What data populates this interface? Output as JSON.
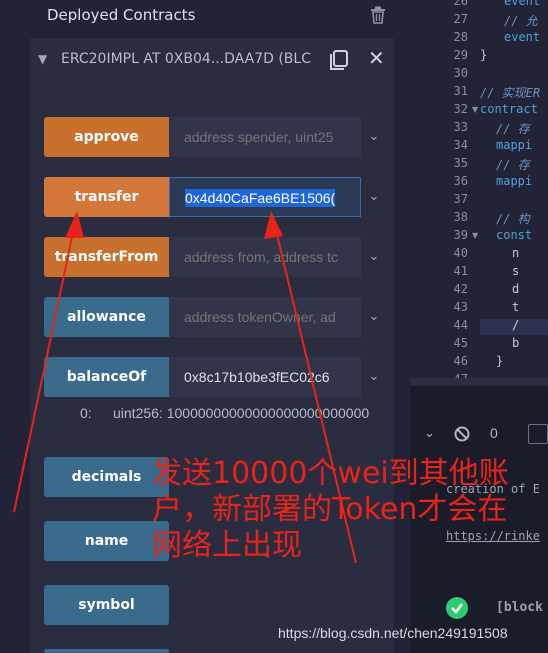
{
  "deployed_panel": {
    "title": "Deployed Contracts",
    "trash_icon": "trash-icon"
  },
  "instance": {
    "title": "ERC20IMPL AT 0XB04...DAA7D (BLC",
    "chevron_icon": "chevron-down-icon",
    "copy_icon": "copy-icon",
    "close_icon": "close-icon"
  },
  "functions": [
    {
      "label": "approve",
      "input_placeholder": "address spender, uint25",
      "input_value": "",
      "style": "orange"
    },
    {
      "label": "transfer",
      "input_placeholder": "",
      "input_value": "0x4d40CaFae6BE1506(",
      "style": "orange-active"
    },
    {
      "label": "transferFrom",
      "input_placeholder": "address from, address tc",
      "input_value": "",
      "style": "orange"
    },
    {
      "label": "allowance",
      "input_placeholder": "address tokenOwner, ad",
      "input_value": "",
      "style": "blue"
    },
    {
      "label": "balanceOf",
      "input_placeholder": "",
      "input_value": "0x8c17b10be3fEC02c6",
      "style": "blue"
    }
  ],
  "balance_result": {
    "index": "0:",
    "value": "uint256: 10000000000000000000000000"
  },
  "getters": [
    {
      "label": "decimals"
    },
    {
      "label": "name"
    },
    {
      "label": "symbol"
    }
  ],
  "editor": {
    "lines": [
      {
        "num": "26",
        "text": "event",
        "kind": "kw",
        "indent": 3
      },
      {
        "num": "27",
        "text": "// 允",
        "kind": "cm",
        "indent": 3
      },
      {
        "num": "28",
        "text": "event",
        "kind": "kw",
        "indent": 3
      },
      {
        "num": "29",
        "text": "}",
        "kind": "pl",
        "indent": 0
      },
      {
        "num": "30",
        "text": "",
        "kind": "pl",
        "indent": 0
      },
      {
        "num": "31",
        "text": "// 实现ER",
        "kind": "cm",
        "indent": 0
      },
      {
        "num": "32",
        "text": "contract",
        "kind": "kw",
        "indent": 0,
        "fold": true
      },
      {
        "num": "33",
        "text": "// 存",
        "kind": "cm",
        "indent": 2
      },
      {
        "num": "34",
        "text": "mappi",
        "kind": "kw",
        "indent": 2
      },
      {
        "num": "35",
        "text": "// 存",
        "kind": "cm",
        "indent": 2
      },
      {
        "num": "36",
        "text": "mappi",
        "kind": "kw",
        "indent": 2
      },
      {
        "num": "37",
        "text": "",
        "kind": "pl",
        "indent": 0
      },
      {
        "num": "38",
        "text": "// 构",
        "kind": "cm",
        "indent": 2
      },
      {
        "num": "39",
        "text": "const",
        "kind": "kw",
        "indent": 2,
        "fold": true
      },
      {
        "num": "40",
        "text": "n",
        "kind": "pl",
        "indent": 4
      },
      {
        "num": "41",
        "text": "s",
        "kind": "pl",
        "indent": 4
      },
      {
        "num": "42",
        "text": "d",
        "kind": "pl",
        "indent": 4
      },
      {
        "num": "43",
        "text": "t",
        "kind": "pl",
        "indent": 4
      },
      {
        "num": "44",
        "text": "/",
        "kind": "pl",
        "indent": 4
      },
      {
        "num": "45",
        "text": "b",
        "kind": "pl",
        "indent": 4
      },
      {
        "num": "46",
        "text": "}",
        "kind": "pl",
        "indent": 2
      },
      {
        "num": "47",
        "text": "",
        "kind": "pl",
        "indent": 0
      }
    ]
  },
  "terminal": {
    "double_chevron_icon": "double-chevron-down-icon",
    "clear_icon": "ban-icon",
    "pending_count": "0",
    "log_line": "creation of E",
    "link_text": "https://rinke",
    "success_icon": "check-circle-icon",
    "block_text": "[block"
  },
  "annotation": {
    "text": "发送10000个wei到其他账户，新部署的Token才会在网络上出现",
    "color": "#e8231a"
  },
  "watermark": "https://blog.csdn.net/chen249191508"
}
